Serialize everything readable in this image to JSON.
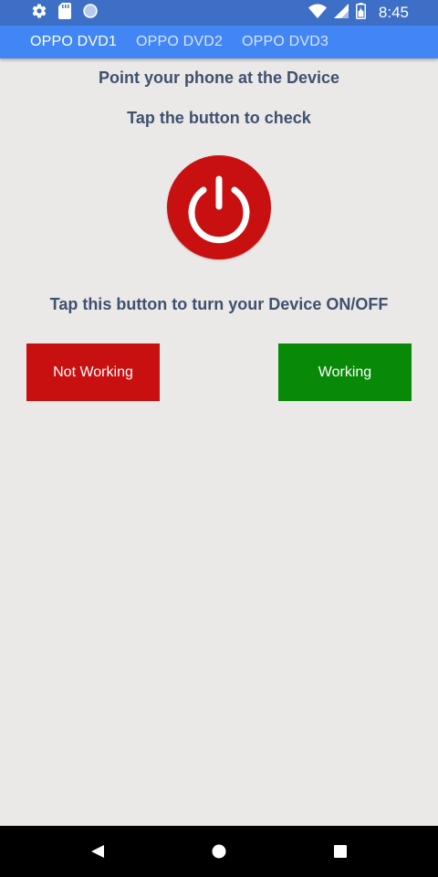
{
  "status_bar": {
    "time": "8:45",
    "icons": [
      "gear-icon",
      "sd-card-icon",
      "circle-icon",
      "wifi-icon",
      "signal-icon",
      "battery-icon"
    ]
  },
  "tabs": [
    {
      "label": "OPPO DVD1",
      "active": true
    },
    {
      "label": "OPPO DVD2",
      "active": false
    },
    {
      "label": "OPPO DVD3",
      "active": false
    }
  ],
  "main": {
    "instruction_point": "Point your phone at the Device",
    "instruction_tap_check": "Tap the button to check",
    "power_button_icon": "power-icon",
    "instruction_toggle": "Tap this button to turn your Device ON/OFF",
    "not_working_label": "Not Working",
    "working_label": "Working"
  },
  "colors": {
    "tab_bar": "#4285f4",
    "status_bar": "#3d6fc6",
    "power_button": "#c81010",
    "not_working_button": "#c81010",
    "working_button": "#088a08",
    "heading_text": "#3f5170",
    "background": "#ebe9e7"
  },
  "nav_bar": {
    "icons": [
      "back-icon",
      "home-icon",
      "recents-icon"
    ]
  }
}
